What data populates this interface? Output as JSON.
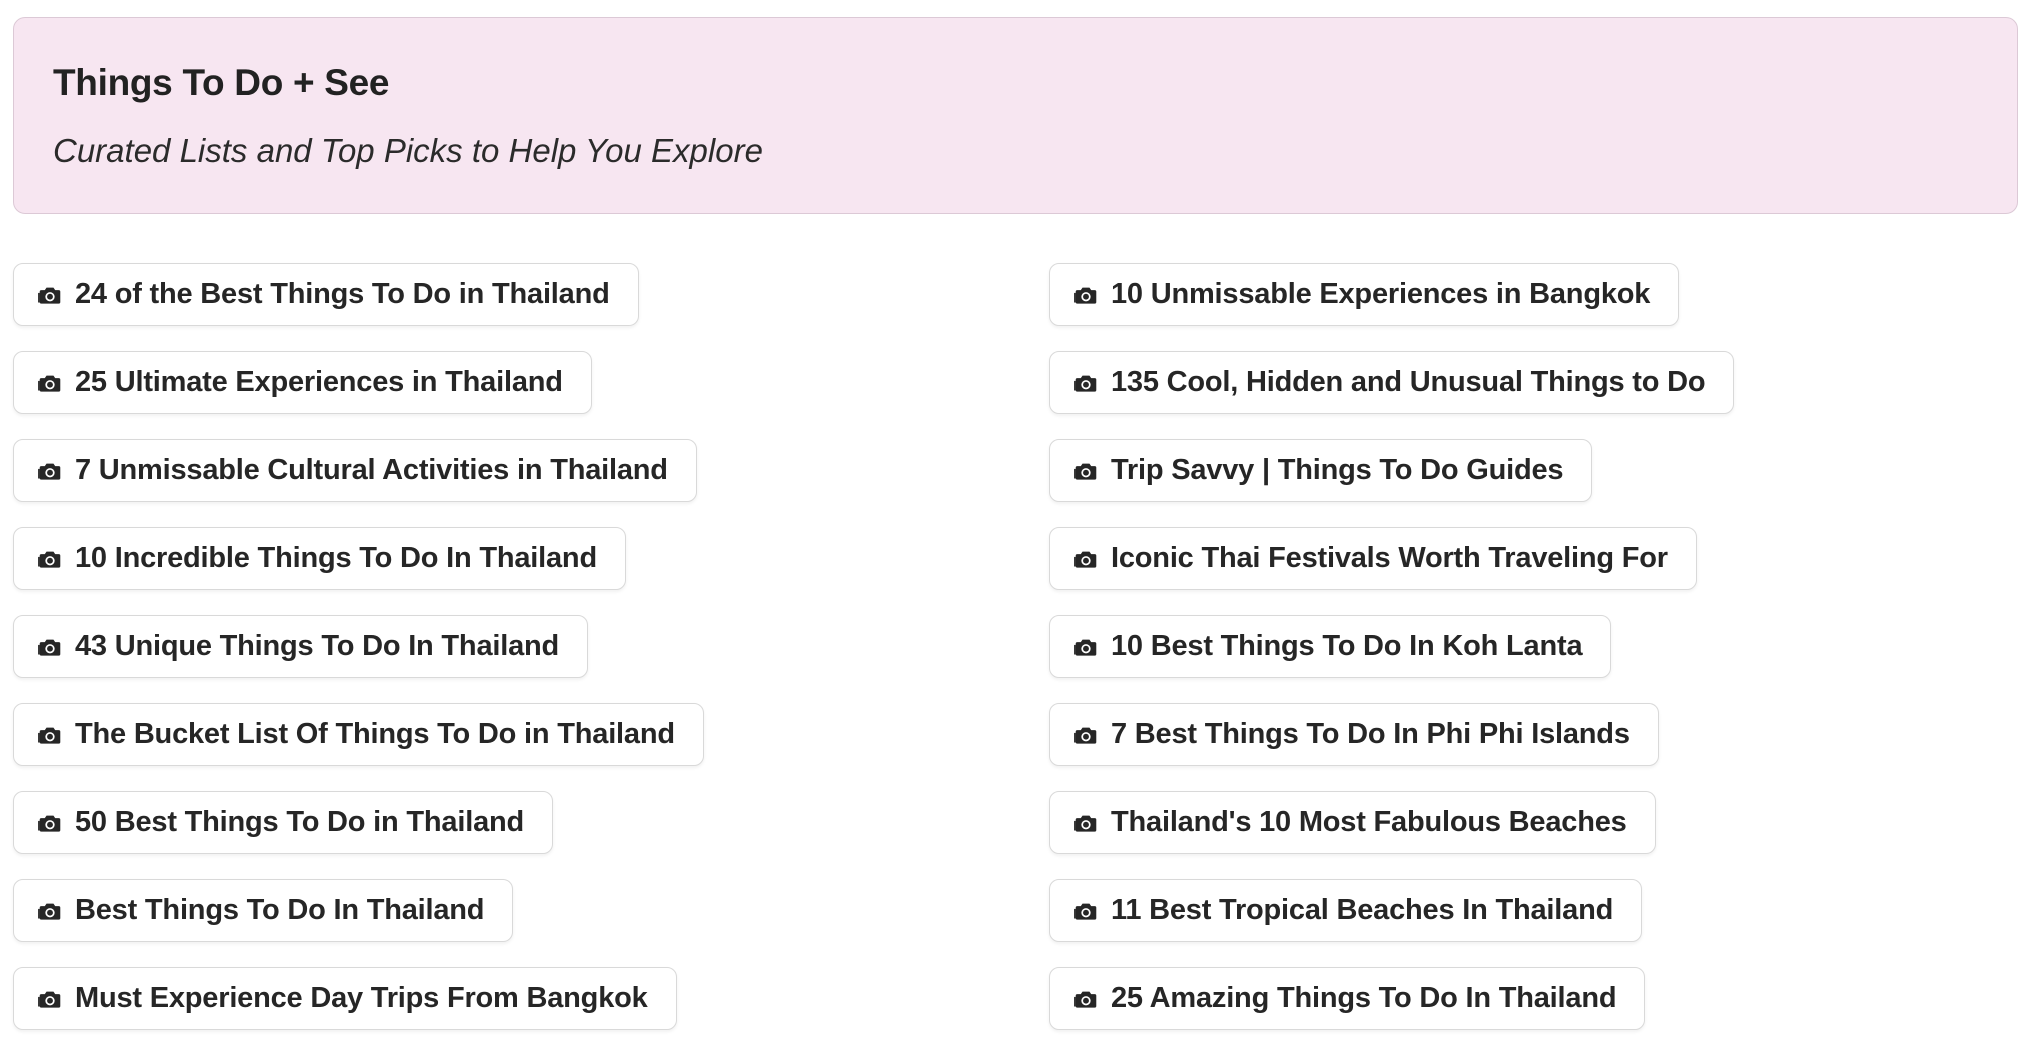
{
  "header": {
    "title": "Things To Do + See",
    "subtitle": "Curated Lists and Top Picks to Help You Explore"
  },
  "links": {
    "icon": "camera-icon",
    "left": [
      {
        "label": "24 of the Best Things To Do in Thailand"
      },
      {
        "label": "25 Ultimate Experiences in Thailand"
      },
      {
        "label": "7 Unmissable Cultural Activities in Thailand"
      },
      {
        "label": "10 Incredible Things To Do In Thailand"
      },
      {
        "label": "43 Unique Things To Do In Thailand"
      },
      {
        "label": "The Bucket List Of Things To Do in Thailand"
      },
      {
        "label": "50 Best Things To Do in Thailand"
      },
      {
        "label": "Best Things To Do In Thailand"
      },
      {
        "label": "Must Experience Day Trips From Bangkok"
      }
    ],
    "right": [
      {
        "label": "10 Unmissable Experiences in Bangkok"
      },
      {
        "label": "135 Cool, Hidden and Unusual Things to Do"
      },
      {
        "label": "Trip Savvy | Things To Do Guides"
      },
      {
        "label": "Iconic Thai Festivals Worth Traveling For"
      },
      {
        "label": "10 Best Things To Do In Koh Lanta"
      },
      {
        "label": "7 Best Things To Do In Phi Phi Islands"
      },
      {
        "label": "Thailand's 10 Most Fabulous Beaches"
      },
      {
        "label": "11 Best Tropical Beaches In Thailand"
      },
      {
        "label": "25 Amazing Things To Do In Thailand"
      }
    ]
  },
  "colors": {
    "hero_background": "#f7e6f1",
    "hero_border": "#dcc9d6",
    "button_border": "#d9d9d9",
    "text": "#262626"
  }
}
